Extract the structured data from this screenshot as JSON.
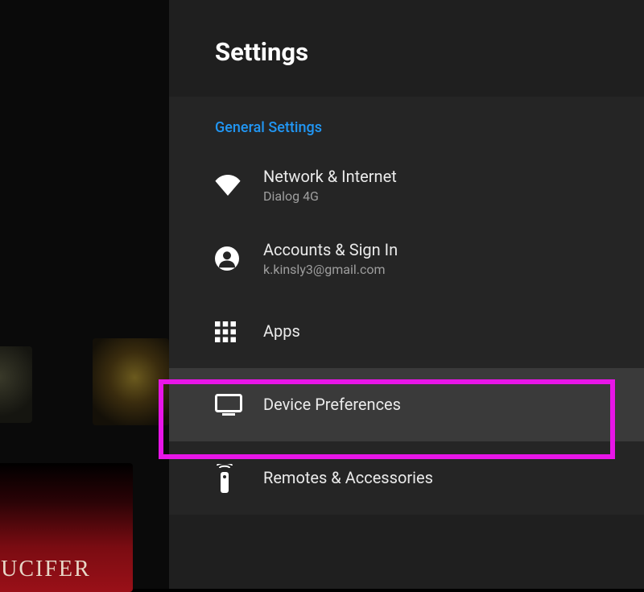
{
  "header": {
    "title": "Settings"
  },
  "section": {
    "label": "General Settings"
  },
  "items": [
    {
      "title": "Network & Internet",
      "sub": "Dialog 4G"
    },
    {
      "title": "Accounts & Sign In",
      "sub": "k.kinsly3@gmail.com"
    },
    {
      "title": "Apps"
    },
    {
      "title": "Device Preferences"
    },
    {
      "title": "Remotes & Accessories"
    }
  ],
  "bg": {
    "poster": "LUCIFER"
  }
}
